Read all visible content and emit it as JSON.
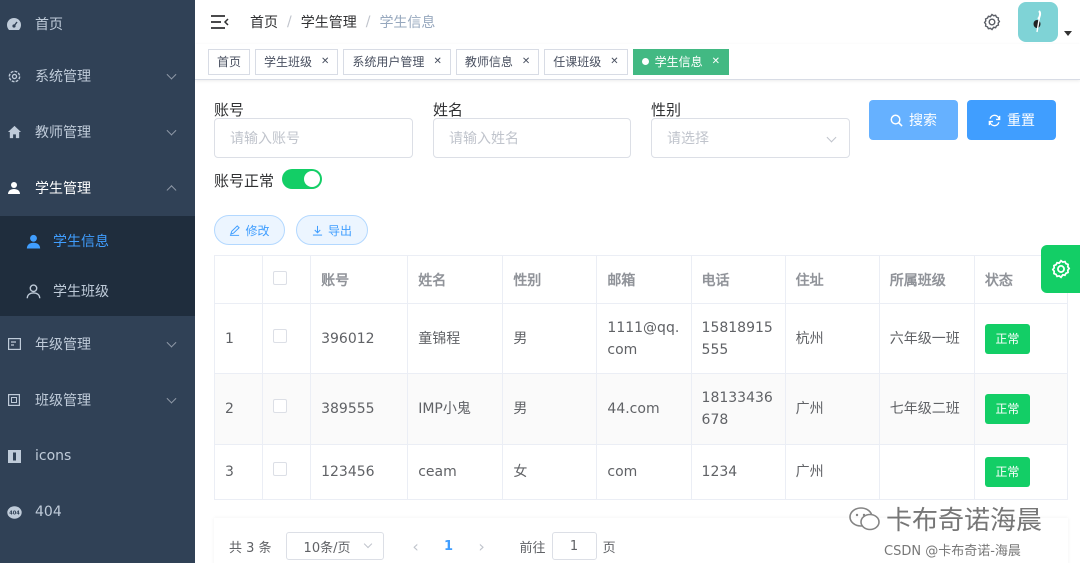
{
  "sidebar": {
    "items": [
      {
        "label": "首页",
        "icon": "dashboard-icon",
        "has_arrow": false
      },
      {
        "label": "系统管理",
        "icon": "gear-icon",
        "has_arrow": true
      },
      {
        "label": "教师管理",
        "icon": "home-icon",
        "has_arrow": true
      },
      {
        "label": "学生管理",
        "icon": "user-icon",
        "has_arrow": true,
        "expanded": true
      },
      {
        "label": "年级管理",
        "icon": "grade-icon",
        "has_arrow": true
      },
      {
        "label": "班级管理",
        "icon": "class-icon",
        "has_arrow": true
      },
      {
        "label": "icons",
        "icon": "icons-icon",
        "has_arrow": false
      },
      {
        "label": "404",
        "icon": "404-icon",
        "has_arrow": false
      }
    ],
    "submenu": [
      {
        "label": "学生信息",
        "icon": "user-solid-icon",
        "active": true
      },
      {
        "label": "学生班级",
        "icon": "user-outline-icon",
        "active": false
      }
    ]
  },
  "navbar": {
    "breadcrumb": [
      "首页",
      "学生管理",
      "学生信息"
    ]
  },
  "tags": [
    {
      "label": "首页",
      "closable": false,
      "active": false
    },
    {
      "label": "学生班级",
      "closable": true,
      "active": false
    },
    {
      "label": "系统用户管理",
      "closable": true,
      "active": false
    },
    {
      "label": "教师信息",
      "closable": true,
      "active": false
    },
    {
      "label": "任课班级",
      "closable": true,
      "active": false
    },
    {
      "label": "学生信息",
      "closable": true,
      "active": true
    }
  ],
  "form": {
    "account_label": "账号",
    "account_placeholder": "请输入账号",
    "name_label": "姓名",
    "name_placeholder": "请输入姓名",
    "gender_label": "性别",
    "gender_placeholder": "请选择",
    "search_label": "搜索",
    "reset_label": "重置",
    "status_label": "账号正常",
    "status_on": true
  },
  "actions": {
    "edit_label": "修改",
    "export_label": "导出"
  },
  "table": {
    "headers": [
      "",
      "",
      "账号",
      "姓名",
      "性别",
      "邮箱",
      "电话",
      "住址",
      "所属班级",
      "状态"
    ],
    "rows": [
      {
        "index": "1",
        "account": "396012",
        "name": "童锦程",
        "gender": "男",
        "email": "1111@qq.com",
        "phone": "15818915555",
        "address": "杭州",
        "class": "六年级一班",
        "status": "正常"
      },
      {
        "index": "2",
        "account": "389555",
        "name": "IMP小鬼",
        "gender": "男",
        "email": "44.com",
        "phone": "18133436678",
        "address": "广州",
        "class": "七年级二班",
        "status": "正常"
      },
      {
        "index": "3",
        "account": "123456",
        "name": "ceam",
        "gender": "女",
        "email": "com",
        "phone": "1234",
        "address": "广州",
        "class": "",
        "status": "正常"
      }
    ]
  },
  "pagination": {
    "total": "共 3 条",
    "page_size": "10条/页",
    "current": "1",
    "goto_prefix": "前往",
    "goto_value": "1",
    "goto_suffix": "页"
  },
  "watermark": {
    "main": "卡布奇诺海晨",
    "csdn": "CSDN @卡布奇诺-海晨"
  },
  "colors": {
    "sidebar_bg": "#304156",
    "submenu_bg": "#1f2d3d",
    "primary": "#409eff",
    "success": "#13ce66",
    "active_tag": "#42b983",
    "search_btn": "#66b1ff"
  }
}
